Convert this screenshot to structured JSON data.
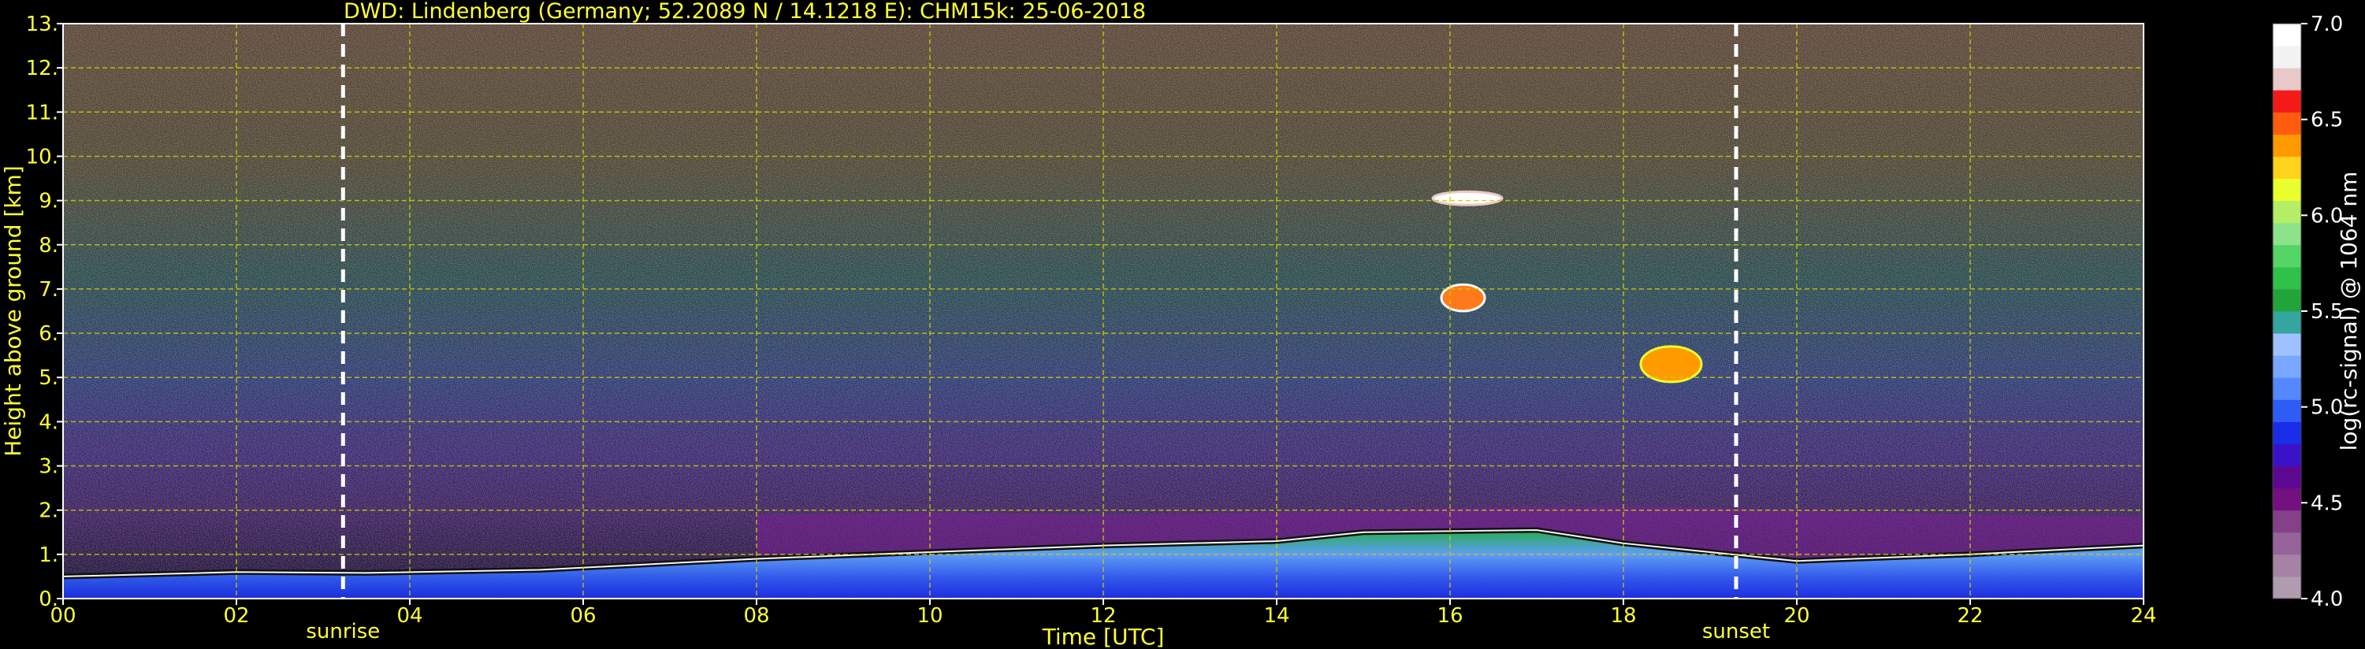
{
  "figure": {
    "title": "DWD: Lindenberg (Germany; 52.2089 N / 14.1218 E):    CHM15k: 25-06-2018"
  },
  "chart_data": {
    "type": "heatmap",
    "title": "DWD: Lindenberg (Germany; 52.2089 N / 14.1218 E):    CHM15k: 25-06-2018",
    "xlabel": "Time [UTC]",
    "ylabel": "Height above ground [km]",
    "xlim": [
      0,
      24
    ],
    "ylim": [
      0,
      13
    ],
    "x_ticks": [
      "00",
      "02",
      "04",
      "06",
      "08",
      "10",
      "12",
      "14",
      "16",
      "18",
      "20",
      "22",
      "24"
    ],
    "y_ticks": [
      "0.",
      "1.",
      "2.",
      "3.",
      "4.",
      "5.",
      "6.",
      "7.",
      "8.",
      "9.",
      "10.",
      "11.",
      "12.",
      "13."
    ],
    "grid": true,
    "annotations": [
      {
        "label": "sunrise",
        "time_utc": 3.23
      },
      {
        "label": "sunset",
        "time_utc": 19.3
      }
    ],
    "colorbar": {
      "label": "log(rc-signal) @ 1064 nm",
      "range": [
        4.0,
        7.0
      ],
      "ticks": [
        "4.0",
        "4.5",
        "5.0",
        "5.5",
        "6.0",
        "6.5",
        "7.0"
      ],
      "colors": [
        "#b09cb0",
        "#a683a6",
        "#96649a",
        "#84418a",
        "#73117f",
        "#5d0891",
        "#3a12c8",
        "#1a2de8",
        "#2e5cf5",
        "#5587ff",
        "#7aa7ff",
        "#9fc1ff",
        "#35a5a0",
        "#23a43a",
        "#30c14a",
        "#55d468",
        "#8de38a",
        "#b3ee66",
        "#eaff2e",
        "#ffd21c",
        "#ff9a00",
        "#ff5c10",
        "#f51a1a",
        "#e8c8c8",
        "#f2f2f2",
        "#ffffff"
      ]
    },
    "features": [
      {
        "name": "boundary layer top",
        "time_utc": [
          0,
          2,
          3.5,
          5.5,
          8,
          10,
          12,
          14,
          15,
          17,
          18,
          20,
          22,
          24
        ],
        "height_km": [
          0.5,
          0.6,
          0.58,
          0.65,
          0.9,
          1.05,
          1.2,
          1.3,
          1.5,
          1.55,
          1.25,
          0.85,
          1.0,
          1.2
        ]
      },
      {
        "name": "cirrus cloud",
        "time_utc": [
          15.8,
          16.6
        ],
        "height_km": [
          8.9,
          9.2
        ]
      },
      {
        "name": "mid-level cloud",
        "time_utc": [
          15.9,
          16.4
        ],
        "height_km": [
          6.5,
          7.1
        ]
      },
      {
        "name": "convective cloud",
        "time_utc": [
          18.2,
          18.9
        ],
        "height_km": [
          4.9,
          5.7
        ]
      }
    ]
  }
}
